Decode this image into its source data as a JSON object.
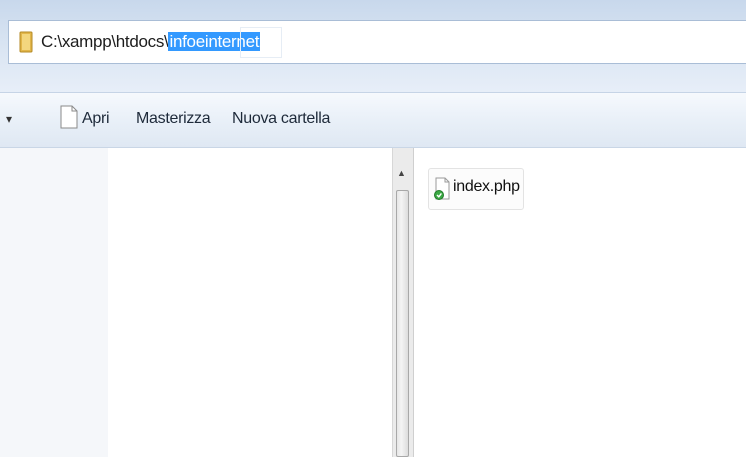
{
  "address_bar": {
    "path_prefix": "C:\\xampp\\htdocs\\",
    "path_selected": "infoeinternet"
  },
  "toolbar": {
    "organize_arrow": "▾",
    "open_label": "Apri",
    "burn_label": "Masterizza",
    "new_folder_label": "Nuova cartella"
  },
  "scrollbar": {
    "up_arrow": "▲"
  },
  "files": [
    {
      "name": "index.php",
      "icon": "php-file-icon"
    }
  ],
  "colors": {
    "selection": "#3399ff",
    "toolbar_bg": "#e9f0f8"
  }
}
